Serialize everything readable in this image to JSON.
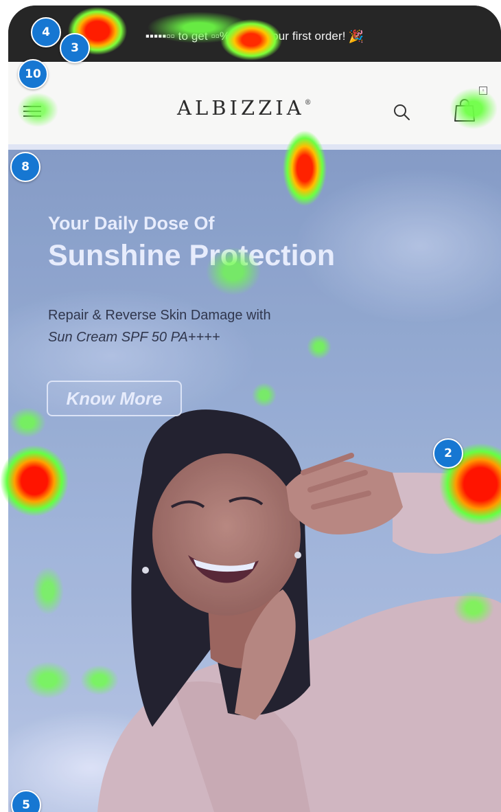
{
  "announcement": {
    "masked_code": "▪▪▪▪▪▫▫",
    "text_1": "to get",
    "masked_percent": "▫▫%",
    "text_2": "off on your first order!",
    "icon": "party-popper-icon"
  },
  "header": {
    "logo": "ALBIZZIA",
    "logo_mark": "®",
    "cart_count": "▫",
    "icons": [
      "menu-icon",
      "search-icon",
      "shopping-bag-icon"
    ]
  },
  "hero": {
    "subtitle": "Your Daily Dose Of",
    "title": "Sunshine Protection",
    "description": "Repair & Reverse Skin Damage with",
    "product": "Sun Cream SPF 50 PA++++",
    "cta": "Know More"
  },
  "markers": [
    "4",
    "3",
    "10",
    "8",
    "2",
    "5"
  ],
  "colors": {
    "announcement_bg": "#262626",
    "header_bg": "#f7f7f6",
    "marker_blue": "#1677d2",
    "hero_sky": "#a1b4cf"
  }
}
